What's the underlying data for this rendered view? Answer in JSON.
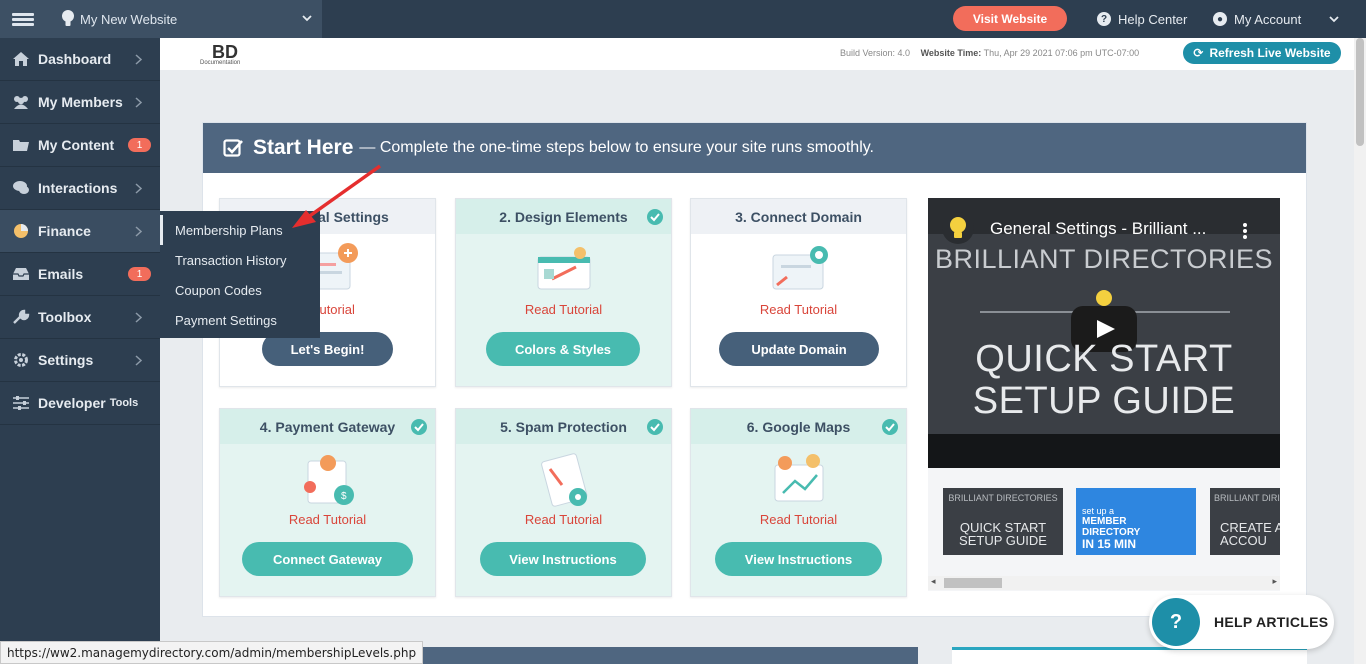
{
  "topbar": {
    "site_name": "My New Website",
    "visit_label": "Visit Website",
    "help_label": "Help Center",
    "account_label": "My Account"
  },
  "sidebar": {
    "items": [
      {
        "label": "Dashboard",
        "icon": "home-icon"
      },
      {
        "label": "My Members",
        "icon": "users-icon"
      },
      {
        "label": "My Content",
        "icon": "folder-icon",
        "badge": "1"
      },
      {
        "label": "Interactions",
        "icon": "chat-icon"
      },
      {
        "label": "Finance",
        "icon": "pie-chart-icon"
      },
      {
        "label": "Emails",
        "icon": "inbox-icon",
        "badge": "1"
      },
      {
        "label": "Toolbox",
        "icon": "wrench-icon"
      },
      {
        "label": "Settings",
        "icon": "gear-icon"
      },
      {
        "label": "Developer",
        "suffix": "Tools",
        "icon": "sliders-icon"
      }
    ]
  },
  "flyout": {
    "items": [
      "Membership Plans",
      "Transaction History",
      "Coupon Codes",
      "Payment Settings"
    ]
  },
  "build": {
    "logo": "BD",
    "logo_sub": "Documentation",
    "version_label": "Build Version: 4.0",
    "time_label": "Website Time:",
    "time_value": "Thu, Apr 29 2021 07:06 pm UTC-07:00",
    "refresh_label": "Refresh Live Website"
  },
  "panel": {
    "title": "Start Here",
    "desc": "— Complete the one-time steps below to ensure your site runs smoothly."
  },
  "cards": [
    {
      "title": "1. General Settings",
      "visible_title": "al Settings",
      "read": "Read Tutorial",
      "button": "Let's Begin!",
      "done": false
    },
    {
      "title": "2. Design Elements",
      "read": "Read Tutorial",
      "button": "Colors & Styles",
      "done": true
    },
    {
      "title": "3. Connect Domain",
      "read": "Read Tutorial",
      "button": "Update Domain",
      "done": false
    },
    {
      "title": "4. Payment Gateway",
      "read": "Read Tutorial",
      "button": "Connect Gateway",
      "done": true
    },
    {
      "title": "5. Spam Protection",
      "read": "Read Tutorial",
      "button": "View Instructions",
      "done": true
    },
    {
      "title": "6. Google Maps",
      "read": "Read Tutorial",
      "button": "View Instructions",
      "done": true
    }
  ],
  "video": {
    "title": "General Settings - Brilliant ...",
    "brand": "BRILLIANT DIRECTORIES",
    "line1": "QUICK START",
    "line2": "SETUP GUIDE"
  },
  "thumbs": {
    "t1_brand": "BRILLIANT DIRECTORIES",
    "t1_l1": "QUICK START",
    "t1_l2": "SETUP GUIDE",
    "t2_l1": "set up a",
    "t2_l2": "MEMBER",
    "t2_l3": "DIRECTORY",
    "t2_l4": "IN 15 MIN",
    "t3_brand": "BRILLIANT DIRI",
    "t3_l1": "CREATE A",
    "t3_l2": "ACCOU"
  },
  "help_articles": "HELP ARTICLES",
  "status_url": "https://ww2.managemydirectory.com/admin/membershipLevels.php",
  "colors": {
    "navy": "#2d3e50",
    "accent_red": "#f26d5b",
    "teal": "#48bbb0",
    "blue": "#1e8fa8"
  }
}
